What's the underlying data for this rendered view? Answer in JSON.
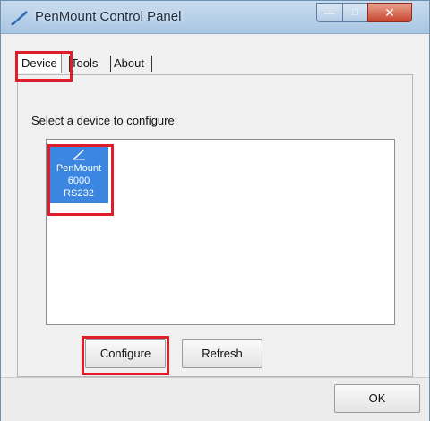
{
  "window": {
    "title": "PenMount Control Panel"
  },
  "tabs": [
    {
      "label": "Device",
      "selected": true
    },
    {
      "label": "Tools",
      "selected": false
    },
    {
      "label": "About",
      "selected": false
    }
  ],
  "device_page": {
    "instruction": "Select a device to configure.",
    "devices": [
      {
        "lines": [
          "PenMount",
          "6000",
          "RS232"
        ],
        "selected": true,
        "icon": "pen-icon"
      }
    ],
    "configure_label": "Configure",
    "refresh_label": "Refresh"
  },
  "footer": {
    "ok_label": "OK"
  },
  "colors": {
    "highlight": "#e01e2a",
    "selection": "#3b86e0"
  }
}
